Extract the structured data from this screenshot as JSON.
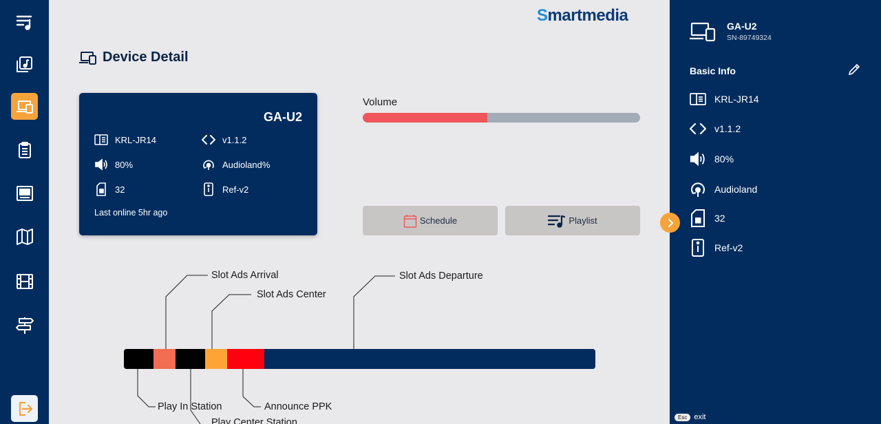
{
  "logo": {
    "first": "S",
    "rest": "martmedia"
  },
  "page_title": "Device Detail",
  "sidebar": {
    "items": [
      {
        "name": "queue-icon",
        "active": false
      },
      {
        "name": "music-library-icon",
        "active": false
      },
      {
        "name": "devices-icon",
        "active": true
      },
      {
        "name": "clipboard-icon",
        "active": false
      },
      {
        "name": "display-icon",
        "active": false
      },
      {
        "name": "map-icon",
        "active": false
      },
      {
        "name": "film-icon",
        "active": false
      },
      {
        "name": "signpost-icon",
        "active": false
      }
    ],
    "logout_icon": "logout-icon"
  },
  "card": {
    "title": "GA-U2",
    "model": "KRL-JR14",
    "version": "v1.1.2",
    "volume": "80%",
    "audio": "Audioland%",
    "storage": "32",
    "ref": "Ref-v2",
    "last_online": "Last online 5hr ago"
  },
  "volume": {
    "label": "Volume",
    "level": 0.45
  },
  "buttons": {
    "schedule": "Schedule",
    "playlist": "Playlist"
  },
  "timeline": {
    "segments": [
      {
        "color": "#000000",
        "share": 43
      },
      {
        "color": "#f26d52",
        "share": 32
      },
      {
        "color": "#000000",
        "share": 43
      },
      {
        "color": "#fea437",
        "share": 32
      },
      {
        "color": "#ff000e",
        "share": 54
      },
      {
        "color": "#022c5e",
        "share": 481
      }
    ],
    "labels": {
      "slot_arrival": "Slot Ads Arrival",
      "slot_center": "Slot Ads Center",
      "slot_departure": "Slot Ads Departure",
      "play_in": "Play In Station",
      "play_center": "Play Center Station",
      "announce": "Announce PPK"
    }
  },
  "panel": {
    "device_name": "GA-U2",
    "serial": "SN-89749324",
    "section": "Basic Info",
    "items": {
      "model": "KRL-JR14",
      "version": "v1.1.2",
      "volume": "80%",
      "audio": "Audioland",
      "storage": "32",
      "ref": "Ref-v2"
    }
  },
  "footer": {
    "key": "Esc",
    "action": "exit"
  }
}
